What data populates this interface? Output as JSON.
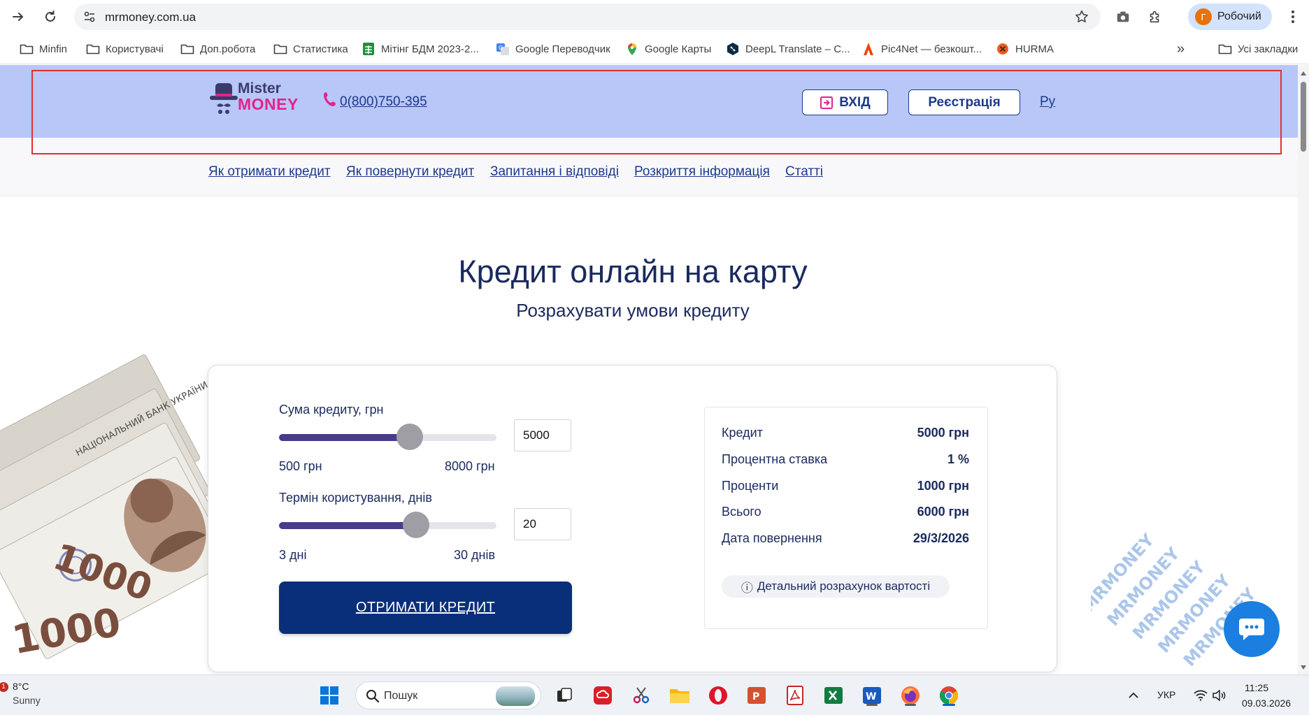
{
  "browser": {
    "url": "mrmoney.com.ua",
    "profile_initial": "Г",
    "profile_name": "Робочий",
    "bookmarks": [
      "Minfin",
      "Користувачі",
      "Доп.робота",
      "Статистика",
      "Мітінг БДМ 2023-2...",
      "Google Переводчик",
      "Google Карты",
      "DeepL Translate – С...",
      "Pic4Net — безкошт...",
      "HURMA"
    ],
    "all_bookmarks": "Усі закладки",
    "more_bookmarks": "»"
  },
  "site": {
    "logo_top": "Mister",
    "logo_bottom": "MONEY",
    "phone": "0(800)750-395",
    "login": "ВХІД",
    "register": "Реєстрація",
    "lang": "Ру",
    "nav": [
      "Як отримати кредит",
      "Як повернути кредит",
      "Запитання і відповіді",
      "Розкриття інформація",
      "Статті"
    ]
  },
  "hero": {
    "title": "Кредит онлайн на карту",
    "subtitle": "Розрахувати умови кредиту"
  },
  "calculator": {
    "amount_label": "Сума кредиту, грн",
    "amount_value": "5000",
    "amount_min": "500 грн",
    "amount_max": "8000 грн",
    "amount_fraction": 0.6,
    "term_label": "Термін користування, днів",
    "term_value": "20",
    "term_min": "3 дні",
    "term_max": "30 днів",
    "term_fraction": 0.63,
    "cta": "ОТРИМАТИ КРЕДИТ",
    "summary": [
      {
        "k": "Кредит",
        "v": "5000 грн"
      },
      {
        "k": "Процентна ставка",
        "v": "1 %"
      },
      {
        "k": "Проценти",
        "v": "1000 грн"
      },
      {
        "k": "Всього",
        "v": "6000 грн"
      },
      {
        "k": "Дата повернення",
        "v": "29/3/2026"
      }
    ],
    "detail_link": "Детальний розрахунок вартості",
    "detail_icon": "ⓘ"
  },
  "banknote_text": {
    "line1": "НАЦІОНАЛЬНИЙ БАНК УКРАЇНИ",
    "denomination": "1000"
  },
  "watermark_text": "MRMONEY",
  "taskbar": {
    "weather_badge": "1",
    "weather_temp": "8°C",
    "weather_desc": "Sunny",
    "search_placeholder": "Пошук",
    "lang": "УКР",
    "time": "11:25",
    "date": "09.03.2026"
  },
  "colors": {
    "header_bg": "#b8c6f8",
    "brand_blue": "#1d3a8a",
    "brand_pink": "#e0258a",
    "cta_bg": "#0a2f7a",
    "slider_fill": "#4a3a8c",
    "highlight_border": "#e03030"
  }
}
